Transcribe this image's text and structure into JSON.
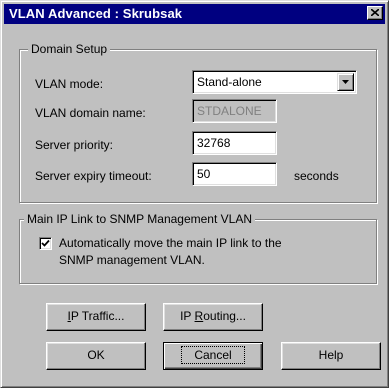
{
  "window": {
    "title": "VLAN Advanced : Skrubsak"
  },
  "domain_setup": {
    "group_label": "Domain Setup",
    "vlan_mode_label": "VLAN mode:",
    "vlan_mode_value": "Stand-alone",
    "domain_name_label": "VLAN domain name:",
    "domain_name_value": "STDALONE",
    "server_priority_label": "Server priority:",
    "server_priority_value": "32768",
    "expiry_timeout_label": "Server expiry timeout:",
    "expiry_timeout_value": "50",
    "expiry_timeout_unit": "seconds"
  },
  "main_ip_link": {
    "group_label": "Main IP Link to SNMP Management VLAN",
    "checkbox_checked": true,
    "checkbox_line1": "Automatically move the main IP link to the",
    "checkbox_line2": "SNMP management VLAN."
  },
  "buttons": {
    "ip_traffic": {
      "mnemonic": "I",
      "rest": "P Traffic..."
    },
    "ip_routing": {
      "first": "IP ",
      "mnemonic": "R",
      "rest": "outing..."
    },
    "ok": "OK",
    "cancel": "Cancel",
    "help": "Help"
  },
  "icons": {
    "close": "close-icon",
    "dropdown": "chevron-down-icon",
    "check": "check-icon"
  },
  "colors": {
    "title_bar": "#000080",
    "face": "#c0c0c0"
  }
}
